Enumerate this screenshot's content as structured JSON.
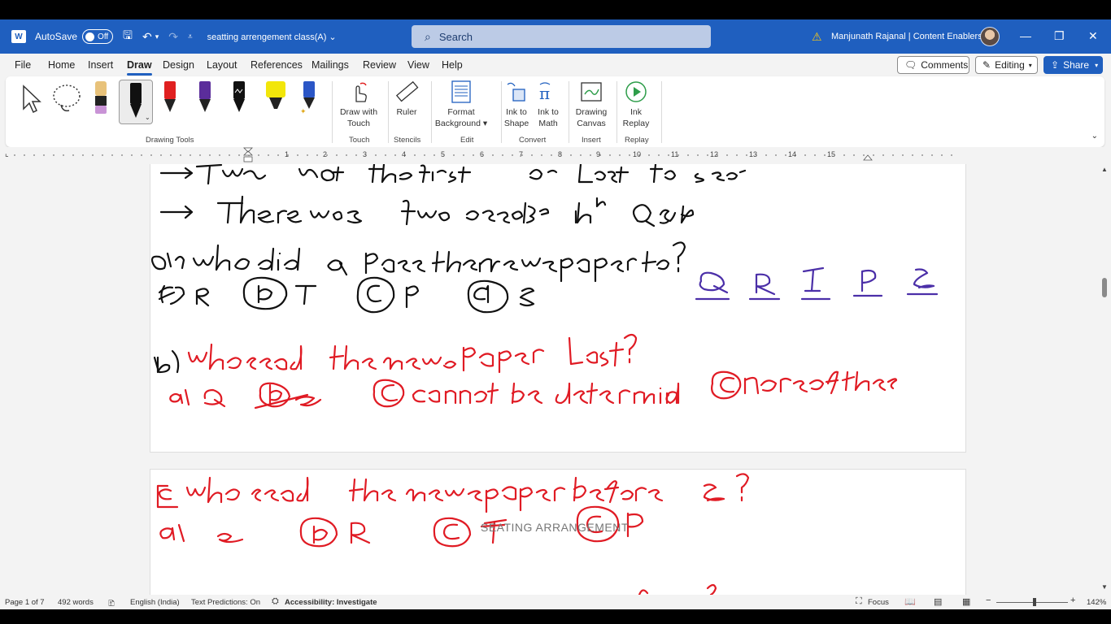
{
  "titlebar": {
    "autosave_label": "AutoSave",
    "autosave_state": "Off",
    "doc_title": "seatting arrengement class(A)",
    "search_placeholder": "Search",
    "user": "Manjunath Rajanal | Content Enablers"
  },
  "menu": {
    "items": [
      "File",
      "Home",
      "Insert",
      "Draw",
      "Design",
      "Layout",
      "References",
      "Mailings",
      "Review",
      "View",
      "Help"
    ],
    "active": "Draw",
    "comments_label": "Comments",
    "editing_label": "Editing",
    "share_label": "Share"
  },
  "ribbon": {
    "groups": {
      "drawing_tools": "Drawing Tools",
      "touch": "Touch",
      "stencils": "Stencils",
      "edit": "Edit",
      "convert": "Convert",
      "insert": "Insert",
      "replay": "Replay"
    },
    "buttons": {
      "draw_with_touch_1": "Draw with",
      "draw_with_touch_2": "Touch",
      "ruler": "Ruler",
      "format_bg_1": "Format",
      "format_bg_2": "Background",
      "ink_to_shape_1": "Ink to",
      "ink_to_shape_2": "Shape",
      "ink_to_math_1": "Ink to",
      "ink_to_math_2": "Math",
      "drawing_canvas_1": "Drawing",
      "drawing_canvas_2": "Canvas",
      "ink_replay_1": "Ink",
      "ink_replay_2": "Replay"
    },
    "pen_colors": [
      "#e8c27a",
      "#111111",
      "#e02020",
      "#5b2d9b",
      "#111111",
      "#f2e60a",
      "#2b56c6"
    ]
  },
  "ruler_numbers": [
    "1",
    "2",
    "3",
    "4",
    "5",
    "6",
    "7",
    "8",
    "9",
    "10",
    "11",
    "12",
    "13",
    "14",
    "15"
  ],
  "document": {
    "watermark": "SEATING ARRANGEMENT",
    "ink_colors": {
      "black": "#111111",
      "red": "#e01b24",
      "purple": "#4b2fa8"
    }
  },
  "statusbar": {
    "page": "Page 1 of 7",
    "words": "492 words",
    "language": "English (India)",
    "predictions": "Text Predictions: On",
    "accessibility": "Accessibility: Investigate",
    "focus": "Focus",
    "zoom": "142%"
  }
}
